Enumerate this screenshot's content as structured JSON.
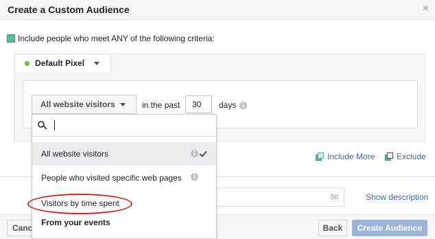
{
  "dialog": {
    "title": "Create a Custom Audience",
    "close_icon": "close-icon"
  },
  "criteria": {
    "label": "Include people who meet ANY of the following criteria:",
    "accent_color": "#5bb89d"
  },
  "pixel": {
    "label": "Default Pixel",
    "status_color": "#6ebf43"
  },
  "rule": {
    "visitors_label": "All website visitors",
    "in_the_past": "in the past",
    "days_value": "30",
    "days_label": "days"
  },
  "dropdown": {
    "search_placeholder": "",
    "items": [
      {
        "label": "All website visitors",
        "selected": true,
        "info": true,
        "checked": true
      },
      {
        "label": "People who visited specific web pages",
        "selected": false,
        "info": true,
        "checked": false
      },
      {
        "label": "Visitors by time spent",
        "selected": false,
        "info": false,
        "checked": false,
        "highlighted": true
      },
      {
        "label": "From your events",
        "heading": true
      }
    ]
  },
  "actions": {
    "include_more": "Include More",
    "exclude": "Exclude"
  },
  "description": {
    "char_count": "50",
    "show_description": "Show description"
  },
  "footer": {
    "cancel": "Cancel",
    "back": "Back",
    "create": "Create Audience"
  },
  "colors": {
    "link": "#4267b2",
    "primary_disabled": "#9cb4d8",
    "annotation_red": "#e0201b"
  }
}
